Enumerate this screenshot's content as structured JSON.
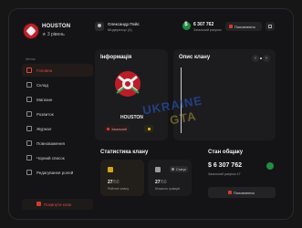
{
  "brand": {
    "name": "HOUSTON",
    "level": "3 рівень"
  },
  "sidebar": {
    "section": "Меню",
    "items": [
      {
        "label": "Головна",
        "active": true
      },
      {
        "label": "Склад"
      },
      {
        "label": "Магазин"
      },
      {
        "label": "Розвиток"
      },
      {
        "label": "Журнал"
      },
      {
        "label": "Повноваження"
      },
      {
        "label": "Чорний список"
      },
      {
        "label": "Редагування ролей"
      }
    ],
    "leave": "Покинути клан"
  },
  "topbar": {
    "user_name": "Олександр Пейс",
    "user_role": "Модератор (4)",
    "balance": "6 307 762",
    "balance_label": "Загальний рахунок",
    "topup": "Поповнення"
  },
  "info": {
    "title": "Інформація",
    "clan_name": "HOUSTON",
    "tag": "Загальний"
  },
  "desc": {
    "title": "Опис клану"
  },
  "watermark": {
    "line1": "UKRAINE",
    "line2": "GTA"
  },
  "stats": {
    "title": "Статистика клану",
    "cards": [
      {
        "value": "27",
        "sub": "/50",
        "label": "Рейтинг клану"
      },
      {
        "value": "27",
        "sub": "/50",
        "label": "Кількість гравців",
        "chip": "Статус"
      }
    ]
  },
  "fund": {
    "title": "Стан общаку",
    "amount": "$ 6 307 762",
    "label": "Загальний рахунок 47",
    "button": "Поповнення"
  },
  "colors": {
    "accent": "#e04a3a",
    "money": "#1f8d3f",
    "gold": "#d6a419"
  }
}
